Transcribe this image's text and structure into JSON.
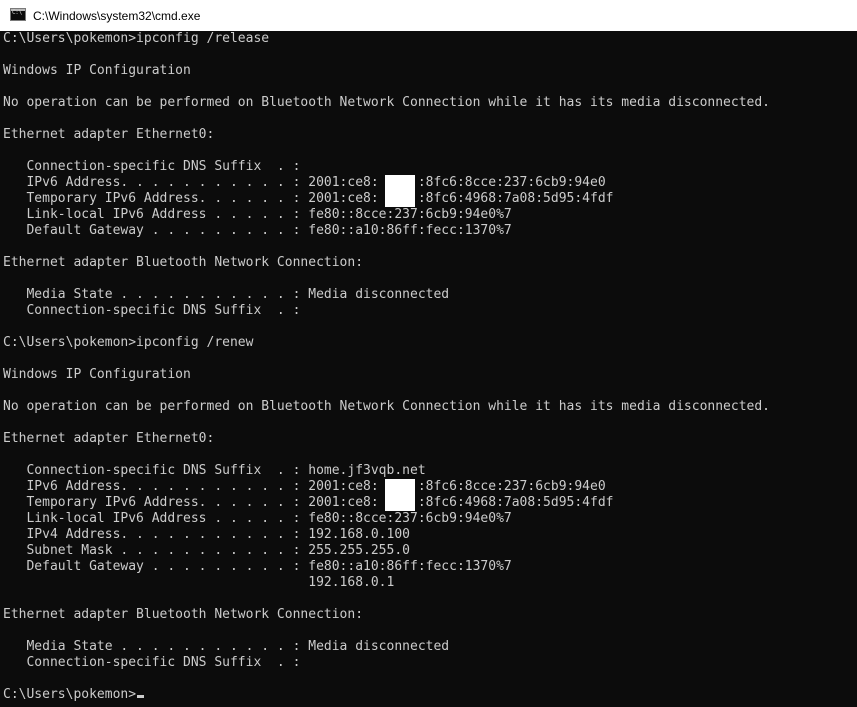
{
  "window": {
    "title": "C:\\Windows\\system32\\cmd.exe",
    "icon": "cmd-icon",
    "icon_glyph": "C:\\"
  },
  "colors": {
    "background": "#0c0c0c",
    "text": "#cccccc",
    "titlebar": "#ffffff",
    "redaction": "#ffffff"
  },
  "console": {
    "lines": [
      "C:\\Users\\pokemon>ipconfig /release",
      "",
      "Windows IP Configuration",
      "",
      "No operation can be performed on Bluetooth Network Connection while it has its media disconnected.",
      "",
      "Ethernet adapter Ethernet0:",
      "",
      "   Connection-specific DNS Suffix  . :",
      "   IPv6 Address. . . . . . . . . . . : 2001:ce8:     :8fc6:8cce:237:6cb9:94e0",
      "   Temporary IPv6 Address. . . . . . : 2001:ce8:     :8fc6:4968:7a08:5d95:4fdf",
      "   Link-local IPv6 Address . . . . . : fe80::8cce:237:6cb9:94e0%7",
      "   Default Gateway . . . . . . . . . : fe80::a10:86ff:fecc:1370%7",
      "",
      "Ethernet adapter Bluetooth Network Connection:",
      "",
      "   Media State . . . . . . . . . . . : Media disconnected",
      "   Connection-specific DNS Suffix  . :",
      "",
      "C:\\Users\\pokemon>ipconfig /renew",
      "",
      "Windows IP Configuration",
      "",
      "No operation can be performed on Bluetooth Network Connection while it has its media disconnected.",
      "",
      "Ethernet adapter Ethernet0:",
      "",
      "   Connection-specific DNS Suffix  . : home.jf3vqb.net",
      "   IPv6 Address. . . . . . . . . . . : 2001:ce8:     :8fc6:8cce:237:6cb9:94e0",
      "   Temporary IPv6 Address. . . . . . : 2001:ce8:     :8fc6:4968:7a08:5d95:4fdf",
      "   Link-local IPv6 Address . . . . . : fe80::8cce:237:6cb9:94e0%7",
      "   IPv4 Address. . . . . . . . . . . : 192.168.0.100",
      "   Subnet Mask . . . . . . . . . . . : 255.255.255.0",
      "   Default Gateway . . . . . . . . . : fe80::a10:86ff:fecc:1370%7",
      "                                       192.168.0.1",
      "",
      "Ethernet adapter Bluetooth Network Connection:",
      "",
      "   Media State . . . . . . . . . . . : Media disconnected",
      "   Connection-specific DNS Suffix  . :",
      ""
    ],
    "prompt": "C:\\Users\\pokemon>"
  }
}
